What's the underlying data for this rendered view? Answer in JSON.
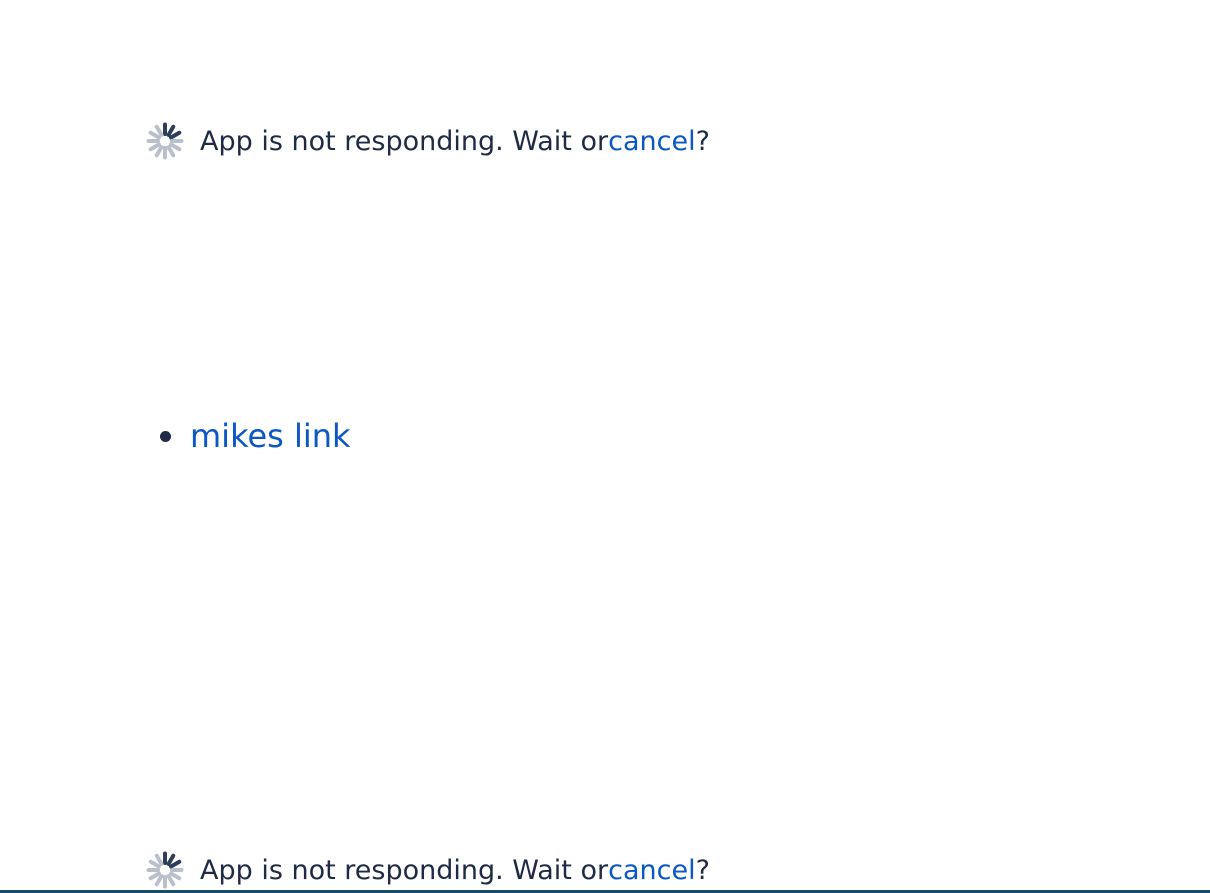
{
  "status_messages": [
    {
      "text": "App is not responding. Wait or ",
      "link_label": "cancel",
      "suffix": "?",
      "icon": "spinner-icon"
    },
    {
      "text": "App is not responding. Wait or ",
      "link_label": "cancel",
      "suffix": "?",
      "icon": "spinner-icon"
    }
  ],
  "links": [
    {
      "label": "mikes link"
    }
  ],
  "colors": {
    "text": "#1f2a44",
    "link": "#0b57c4",
    "spinner_dark": "#2c3e5c",
    "spinner_light": "#b9c0cb",
    "rule": "#1e4b67"
  }
}
